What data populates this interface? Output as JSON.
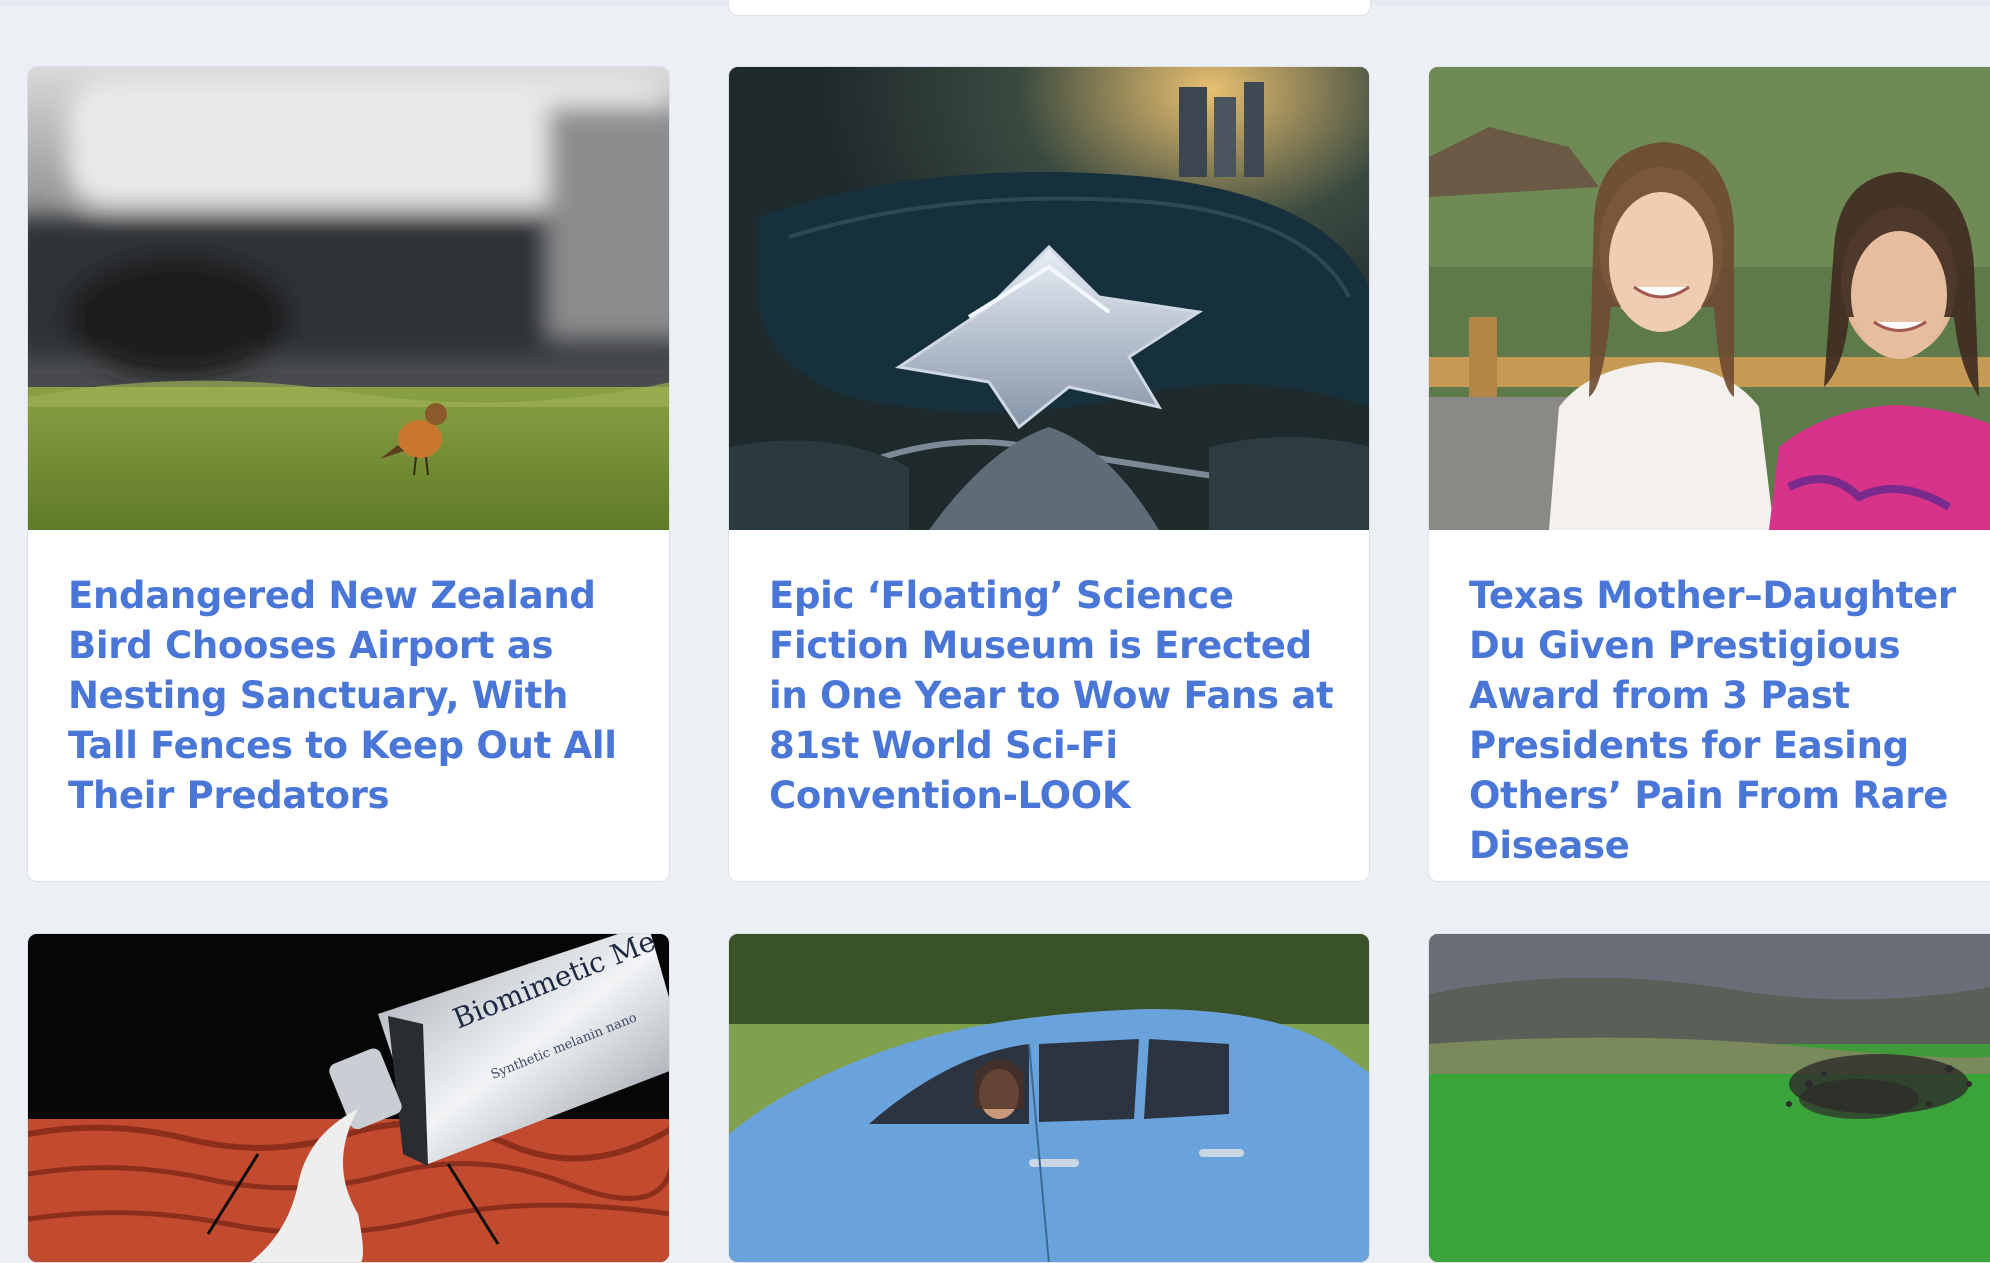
{
  "colors": {
    "page_background": "#eceff4",
    "card_background": "#ffffff",
    "headline_link": "#4a76d8"
  },
  "cards": [
    {
      "title": "Endangered New Zealand Bird Chooses Airport as Nesting Sanctuary, With Tall Fences to Keep Out All Their Predators",
      "image": "bird-on-grass-near-airplane"
    },
    {
      "title": "Epic ‘Floating’ Science Fiction Museum is Erected in One Year to Wow Fans at 81st World Sci-Fi Convention-LOOK",
      "image": "aerial-star-shaped-museum-by-lake"
    },
    {
      "title": "Texas Mother–Daughter Du Given Prestigious Award from 3 Past Presidents for Easing Others’ Pain From Rare Disease",
      "image": "mother-and-daughter-portrait"
    },
    {
      "title": "",
      "image": "biomimetic-cream-tube"
    },
    {
      "title": "",
      "image": "woman-in-blue-electric-car"
    },
    {
      "title": "",
      "image": "flock-of-birds-over-green-field"
    }
  ],
  "thumbnail_text": {
    "tube_label": "Biomimetic Me",
    "tube_sublabel": "Synthetic melanin nano"
  }
}
